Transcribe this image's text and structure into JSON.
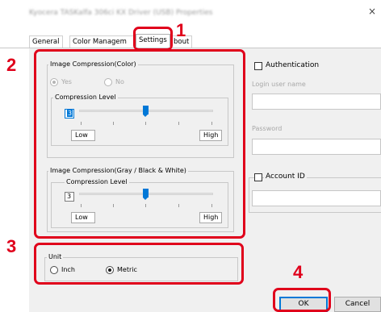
{
  "window": {
    "title": "Kyocera TASKalfa 306ci KX Driver (USB) Properties",
    "close_glyph": "×"
  },
  "tabs": [
    {
      "label": "General"
    },
    {
      "label": "Color Managem"
    },
    {
      "label": "Settings"
    },
    {
      "label": "bout"
    }
  ],
  "annotations": {
    "step1": "1",
    "step2": "2",
    "step3": "3",
    "step4": "4",
    "highlight_color": "#e0001b"
  },
  "image_compression_color": {
    "title": "Image Compression(Color)",
    "yes_label": "Yes",
    "no_label": "No",
    "selected": "Yes",
    "enabled": false,
    "compression_group_title": "Compression Level",
    "level_value": "3",
    "low_label": "Low",
    "high_label": "High"
  },
  "image_compression_gray": {
    "title": "Image Compression(Gray / Black & White)",
    "compression_group_title": "Compression Level",
    "level_value": "3",
    "low_label": "Low",
    "high_label": "High"
  },
  "unit": {
    "title": "Unit",
    "inch_label": "Inch",
    "metric_label": "Metric",
    "selected": "Metric"
  },
  "authentication": {
    "checkbox_label": "Authentication",
    "checked": false,
    "login_label": "Login user name",
    "login_value": "",
    "password_label": "Password",
    "password_value": ""
  },
  "account_id": {
    "checkbox_label": "Account ID",
    "checked": false,
    "value": ""
  },
  "buttons": {
    "ok": "OK",
    "cancel": "Cancel"
  },
  "colors": {
    "accent": "#0078d7",
    "panel_bg": "#f0f0f0"
  }
}
